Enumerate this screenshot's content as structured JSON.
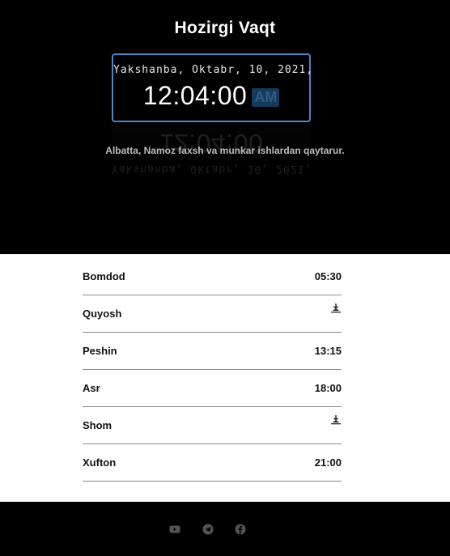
{
  "header": {
    "title": "Hozirgi Vaqt",
    "date_text": "Yakshanba, Oktabr, 10, 2021,",
    "time_text": "12:04:00",
    "ampm": "AM",
    "quote": "Albatta, Namoz faxsh va munkar ishlardan qaytarur."
  },
  "prayers": [
    {
      "name": "Bomdod",
      "time": "05:30"
    },
    {
      "name": "Quyosh",
      "time": "",
      "icon": "sunrise-icon"
    },
    {
      "name": "Peshin",
      "time": "13:15"
    },
    {
      "name": "Asr",
      "time": "18:00"
    },
    {
      "name": "Shom",
      "time": "",
      "icon": "sunrise-icon"
    },
    {
      "name": "Xufton",
      "time": "21:00"
    }
  ],
  "footer": {
    "icons": [
      "youtube-icon",
      "telegram-icon",
      "facebook-icon"
    ]
  },
  "colors": {
    "accent_border": "#4a86c8",
    "ampm_bg": "#163a5a",
    "background": "#000000"
  }
}
